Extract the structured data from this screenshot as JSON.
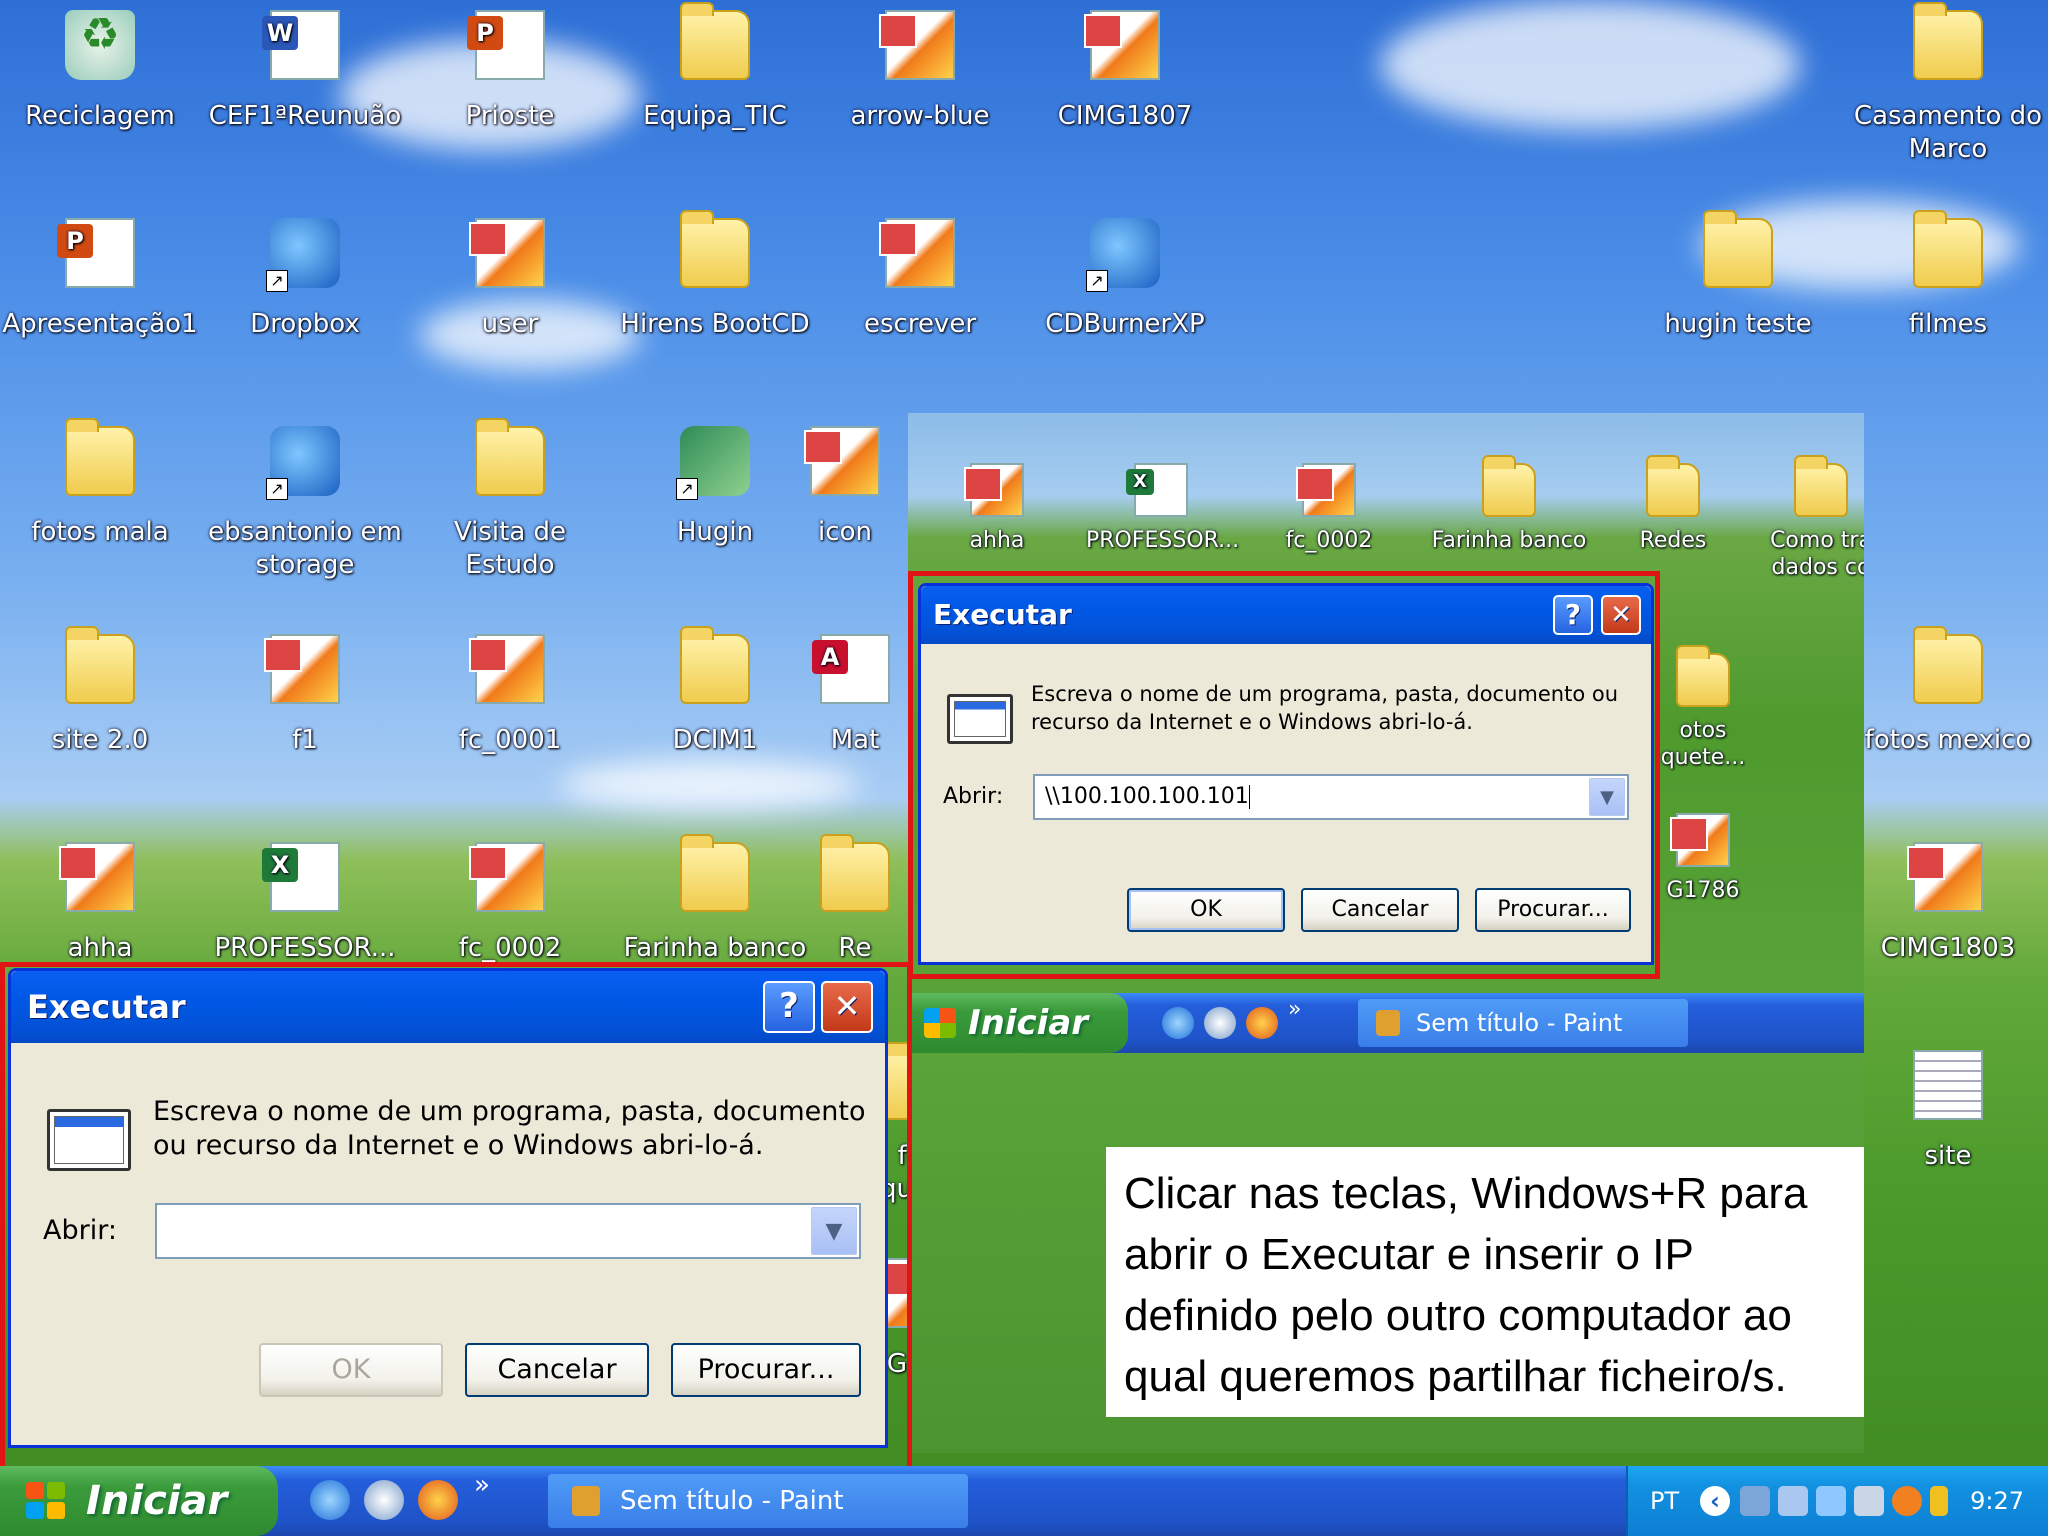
{
  "desktop": {
    "icons": [
      {
        "label": "Reciclagem",
        "type": "recycle"
      },
      {
        "label": "CEF1ªReunuão",
        "type": "word"
      },
      {
        "label": "Prioste",
        "type": "ppt"
      },
      {
        "label": "Equipa_TIC",
        "type": "folder"
      },
      {
        "label": "arrow-blue",
        "type": "image"
      },
      {
        "label": "CIMG1807",
        "type": "image"
      },
      {
        "label": "Casamento do Marco",
        "type": "folder"
      },
      {
        "label": "Apresentação1",
        "type": "ppt"
      },
      {
        "label": "Dropbox",
        "type": "app-shortcut"
      },
      {
        "label": "user",
        "type": "image"
      },
      {
        "label": "Hirens BootCD",
        "type": "folder"
      },
      {
        "label": "escrever",
        "type": "image"
      },
      {
        "label": "CDBurnerXP",
        "type": "app-shortcut"
      },
      {
        "label": "hugin teste",
        "type": "folder"
      },
      {
        "label": "filmes",
        "type": "folder"
      },
      {
        "label": "fotos mala",
        "type": "folder"
      },
      {
        "label": "ebsantonio em storage",
        "type": "app-shortcut"
      },
      {
        "label": "Visita de Estudo",
        "type": "folder"
      },
      {
        "label": "Hugin",
        "type": "app-shortcut"
      },
      {
        "label": "icon",
        "type": "image"
      },
      {
        "label": "site 2.0",
        "type": "folder"
      },
      {
        "label": "f1",
        "type": "image"
      },
      {
        "label": "fc_0001",
        "type": "image"
      },
      {
        "label": "DCIM1",
        "type": "folder"
      },
      {
        "label": "Mat",
        "type": "pdf"
      },
      {
        "label": "fotos mexico",
        "type": "folder"
      },
      {
        "label": "ahha",
        "type": "image"
      },
      {
        "label": "PROFESSOR...",
        "type": "excel"
      },
      {
        "label": "fc_0002",
        "type": "image"
      },
      {
        "label": "Farinha banco",
        "type": "folder"
      },
      {
        "label": "Re",
        "type": "folder"
      },
      {
        "label": "CIMG1803",
        "type": "image"
      },
      {
        "label": "site",
        "type": "notepad"
      }
    ],
    "inset_icons": [
      {
        "label": "ahha",
        "type": "image"
      },
      {
        "label": "PROFESSOR...",
        "type": "excel"
      },
      {
        "label": "fc_0002",
        "type": "image"
      },
      {
        "label": "Farinha banco",
        "type": "folder"
      },
      {
        "label": "Redes",
        "type": "folder"
      },
      {
        "label": "Como tra dados co",
        "type": "folder"
      },
      {
        "label": "otos quete...",
        "type": "folder"
      },
      {
        "label": "G1786",
        "type": "image"
      }
    ],
    "behind_icons": [
      {
        "label": "fotos quete..."
      },
      {
        "label": "G1786"
      }
    ]
  },
  "dialog_main": {
    "title": "Executar",
    "help_glyph": "?",
    "close_glyph": "✕",
    "prompt": "Escreva o nome de um programa, pasta, documento ou recurso da Internet e o Windows abri-lo-á.",
    "field_label": "Abrir:",
    "field_value": "",
    "ok_label": "OK",
    "cancel_label": "Cancelar",
    "browse_label": "Procurar..."
  },
  "dialog_inset": {
    "title": "Executar",
    "help_glyph": "?",
    "close_glyph": "✕",
    "prompt": "Escreva o nome de um programa, pasta, documento ou recurso da Internet e o Windows abri-lo-á.",
    "field_label": "Abrir:",
    "field_value": "\\\\100.100.100.101",
    "ok_label": "OK",
    "cancel_label": "Cancelar",
    "browse_label": "Procurar..."
  },
  "taskbar": {
    "start_label": "Iniciar",
    "overflow_glyph": "»",
    "task_label": "Sem título - Paint",
    "language": "PT",
    "clock": "9:27"
  },
  "inset_taskbar": {
    "start_label": "Iniciar",
    "overflow_glyph": "»",
    "task_label": "Sem título - Paint"
  },
  "caption": {
    "text": "Clicar nas teclas, Windows+R para abrir o Executar e inserir o IP definido pelo outro computador ao qual queremos partilhar ficheiro/s."
  },
  "colors": {
    "highlight_box": "#e01414",
    "xp_title_blue": "#0058e6",
    "start_green": "#3b9b3b"
  }
}
